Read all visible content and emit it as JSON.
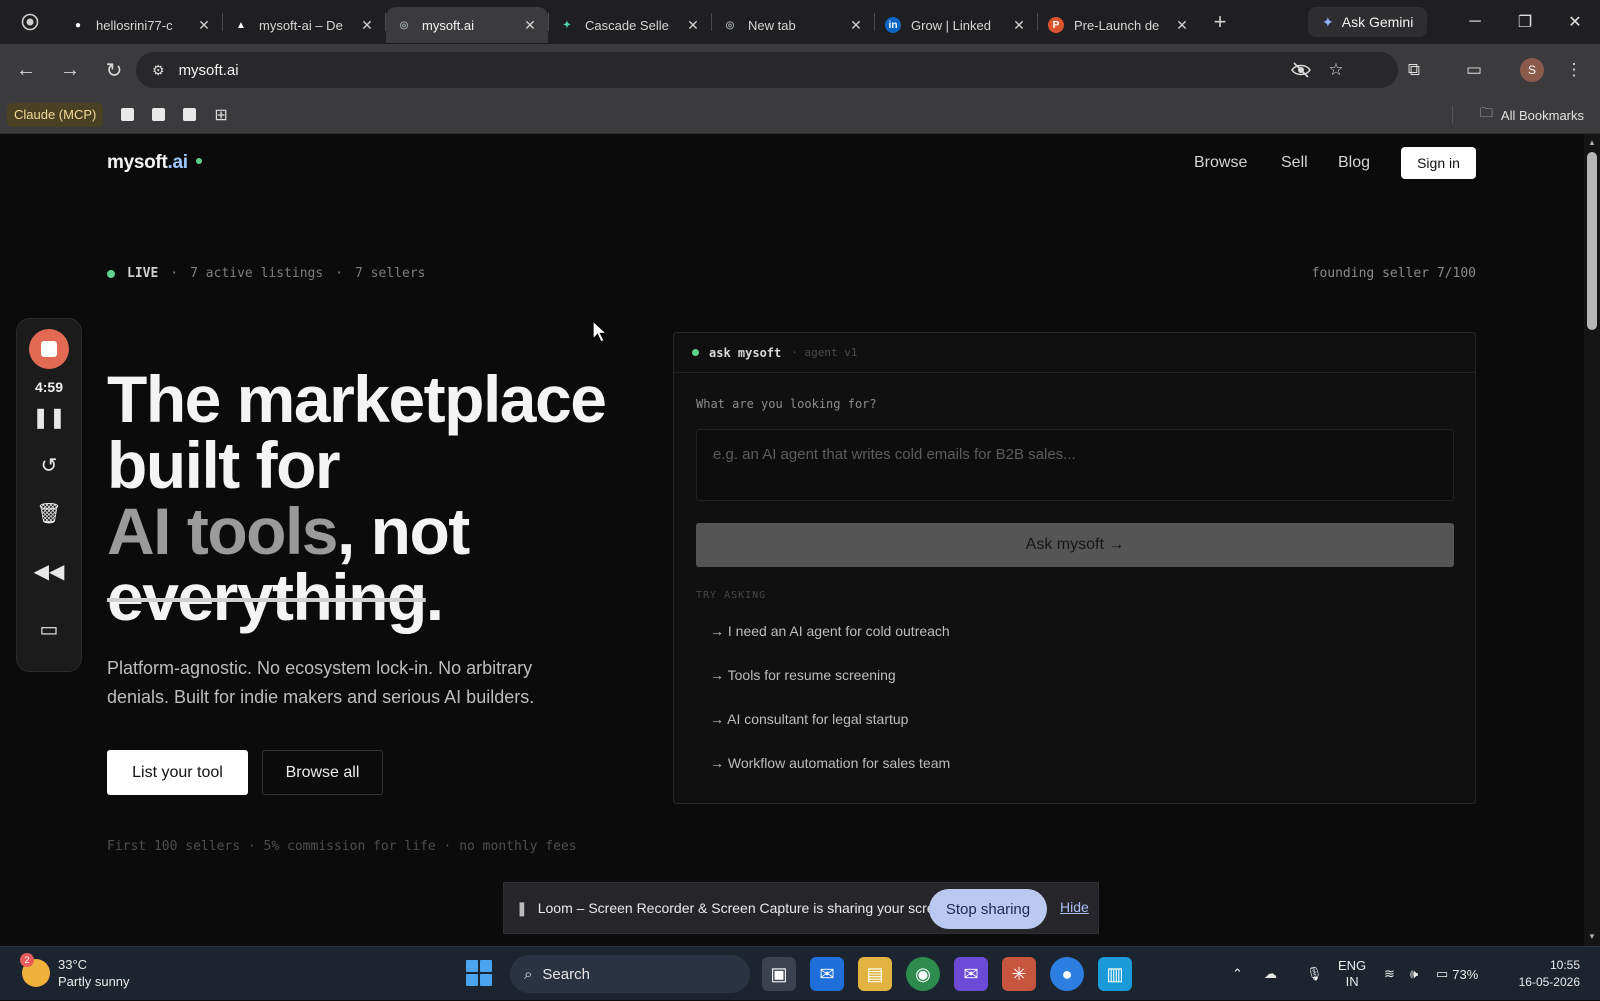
{
  "browser": {
    "tabs": [
      {
        "title": "hellosrini77-c",
        "favicon": "github-icon",
        "color": "#ffffff"
      },
      {
        "title": "mysoft-ai – De",
        "favicon": "vercel-icon",
        "color": "#ffffff"
      },
      {
        "title": "mysoft.ai",
        "favicon": "globe-icon",
        "color": "#9aa0a6",
        "active": true
      },
      {
        "title": "Cascade Selle",
        "favicon": "cascade-icon",
        "color": "#4fd1a5"
      },
      {
        "title": "New tab",
        "favicon": "globe-icon",
        "color": "#9aa0a6"
      },
      {
        "title": "Grow | Linked",
        "favicon": "linkedin-icon",
        "color": "#0a66c2"
      },
      {
        "title": "Pre-Launch de",
        "favicon": "product-hunt-icon",
        "color": "#da552f"
      }
    ],
    "gemini_label": "Ask Gemini",
    "url": "mysoft.ai",
    "profile_initial": "S",
    "bookmarks": {
      "claude_label": "Claude (MCP)",
      "all_label": "All Bookmarks"
    }
  },
  "site": {
    "brand": "mysoft",
    "brand_suffix": ".ai",
    "nav": {
      "browse": "Browse",
      "sell": "Sell",
      "blog": "Blog",
      "signin": "Sign in"
    },
    "status": {
      "live": "LIVE",
      "sep": "·",
      "listings": "7 active listings",
      "sellers": "7 sellers",
      "founding": "founding seller 7/100"
    },
    "hero": {
      "line1": "The marketplace",
      "line2": "built for",
      "line3_dim": "AI tools",
      "line3_rest": ", not",
      "line4_strike": "everything",
      "line4_end": ".",
      "subtitle": "Platform-agnostic. No ecosystem lock-in. No arbitrary denials. Built for indie makers and serious AI builders.",
      "primary_cta": "List your tool",
      "secondary_cta": "Browse all",
      "footnote": "First 100 sellers · 5% commission for life · no monthly fees"
    },
    "agent_card": {
      "title": "ask mysoft",
      "subtitle": "· agent v1",
      "prompt_label": "What are you looking for?",
      "input_placeholder": "e.g. an AI agent that writes cold emails for B2B sales...",
      "button": "Ask mysoft →",
      "try_label": "TRY ASKING",
      "suggestions": [
        "→ I need an AI agent for cold outreach",
        "→ Tools for resume screening",
        "→ AI consultant for legal startup",
        "→ Workflow automation for sales team"
      ]
    }
  },
  "loom": {
    "timer": "4:59",
    "share_text": "Loom – Screen Recorder & Screen Capture is sharing your screen.",
    "stop_label": "Stop sharing",
    "hide_label": "Hide"
  },
  "taskbar": {
    "temperature": "33°C",
    "weather": "Partly sunny",
    "weather_badge": "2",
    "search": "Search",
    "language_top": "ENG",
    "language_bottom": "IN",
    "battery": "73%",
    "time": "10:55",
    "date": "16-05-2026"
  }
}
